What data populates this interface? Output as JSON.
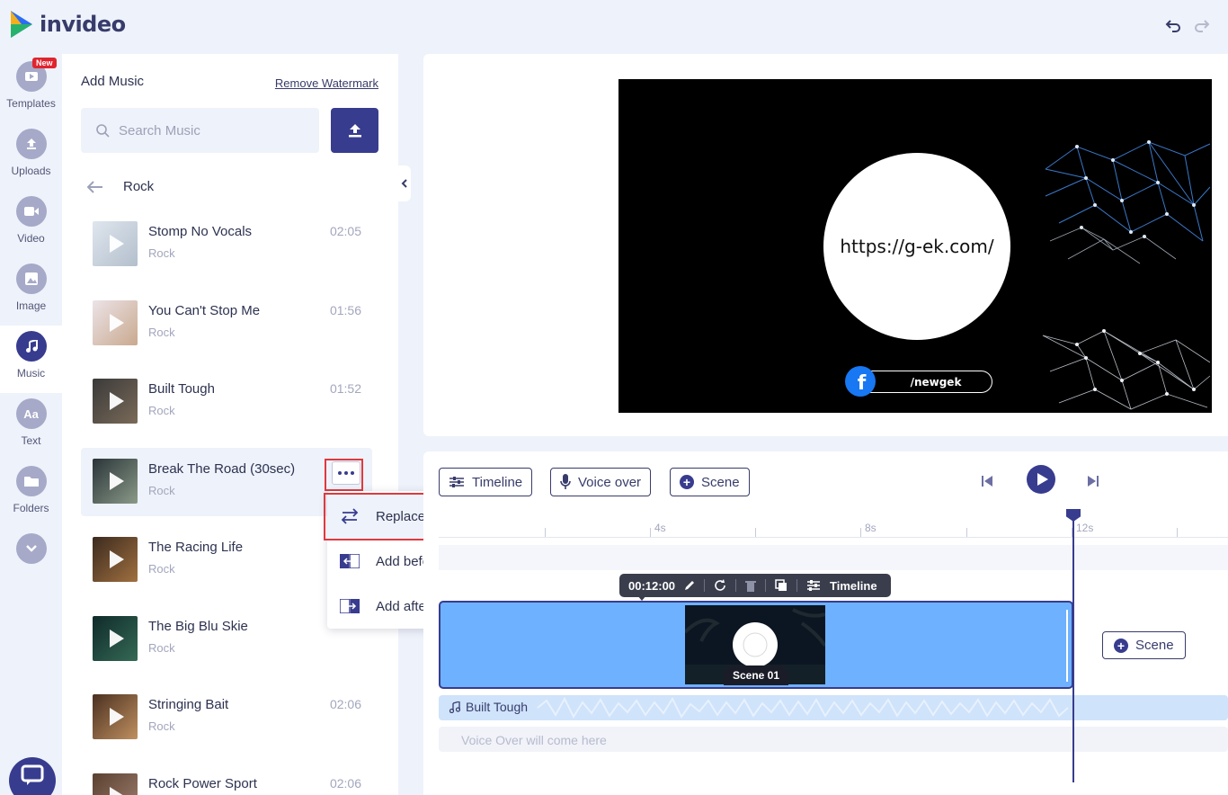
{
  "app": {
    "brand": "invideo"
  },
  "header": {
    "undo_icon": "undo-icon",
    "redo_icon": "redo-icon"
  },
  "sidebar": {
    "new_badge": "New",
    "items": [
      {
        "label": "Templates",
        "icon": "templates-icon"
      },
      {
        "label": "Uploads",
        "icon": "upload-icon"
      },
      {
        "label": "Video",
        "icon": "video-camera-icon"
      },
      {
        "label": "Image",
        "icon": "image-icon"
      },
      {
        "label": "Music",
        "icon": "music-note-icon",
        "active": true
      },
      {
        "label": "Text",
        "icon": "text-icon",
        "glyph": "Aa"
      },
      {
        "label": "Folders",
        "icon": "folder-icon"
      }
    ],
    "more_icon": "chevron-down-icon",
    "chat_icon": "chat-icon"
  },
  "music_panel": {
    "title": "Add Music",
    "remove_watermark": "Remove Watermark",
    "search_placeholder": "Search Music",
    "category": "Rock",
    "tracks": [
      {
        "name": "Stomp No Vocals",
        "genre": "Rock",
        "duration": "02:05"
      },
      {
        "name": "You Can't Stop Me",
        "genre": "Rock",
        "duration": "01:56"
      },
      {
        "name": "Built Tough",
        "genre": "Rock",
        "duration": "01:52"
      },
      {
        "name": "Break The Road (30sec)",
        "genre": "Rock",
        "duration": ""
      },
      {
        "name": "The Racing Life",
        "genre": "Rock",
        "duration": ""
      },
      {
        "name": "The Big Blu Skie",
        "genre": "Rock",
        "duration": ""
      },
      {
        "name": "Stringing Bait",
        "genre": "Rock",
        "duration": "02:06"
      },
      {
        "name": "Rock Power Sport",
        "genre": "Rock",
        "duration": "02:06"
      }
    ],
    "context_menu": [
      {
        "label": "Replace music",
        "icon": "swap-icon"
      },
      {
        "label": "Add before track",
        "icon": "add-before-icon"
      },
      {
        "label": "Add after track",
        "icon": "add-after-icon"
      }
    ]
  },
  "preview": {
    "url_text": "https://g-ek.com/",
    "handle": "/newgek",
    "fb_glyph": "f"
  },
  "timeline": {
    "buttons": {
      "timeline": "Timeline",
      "voice_over": "Voice over",
      "scene": "Scene"
    },
    "ruler_labels": [
      "4s",
      "8s",
      "12s"
    ],
    "clip_toolbar": {
      "duration": "00:12:00",
      "timeline": "Timeline"
    },
    "scene_label": "Scene 01",
    "add_scene": "Scene",
    "music_track": "Built Tough",
    "voice_placeholder": "Voice Over will come here",
    "colors": {
      "accent": "#383c8f",
      "scene_bar": "#6eb1ff",
      "music_bar": "#cfe3fb",
      "highlight": "#e0393e"
    }
  }
}
